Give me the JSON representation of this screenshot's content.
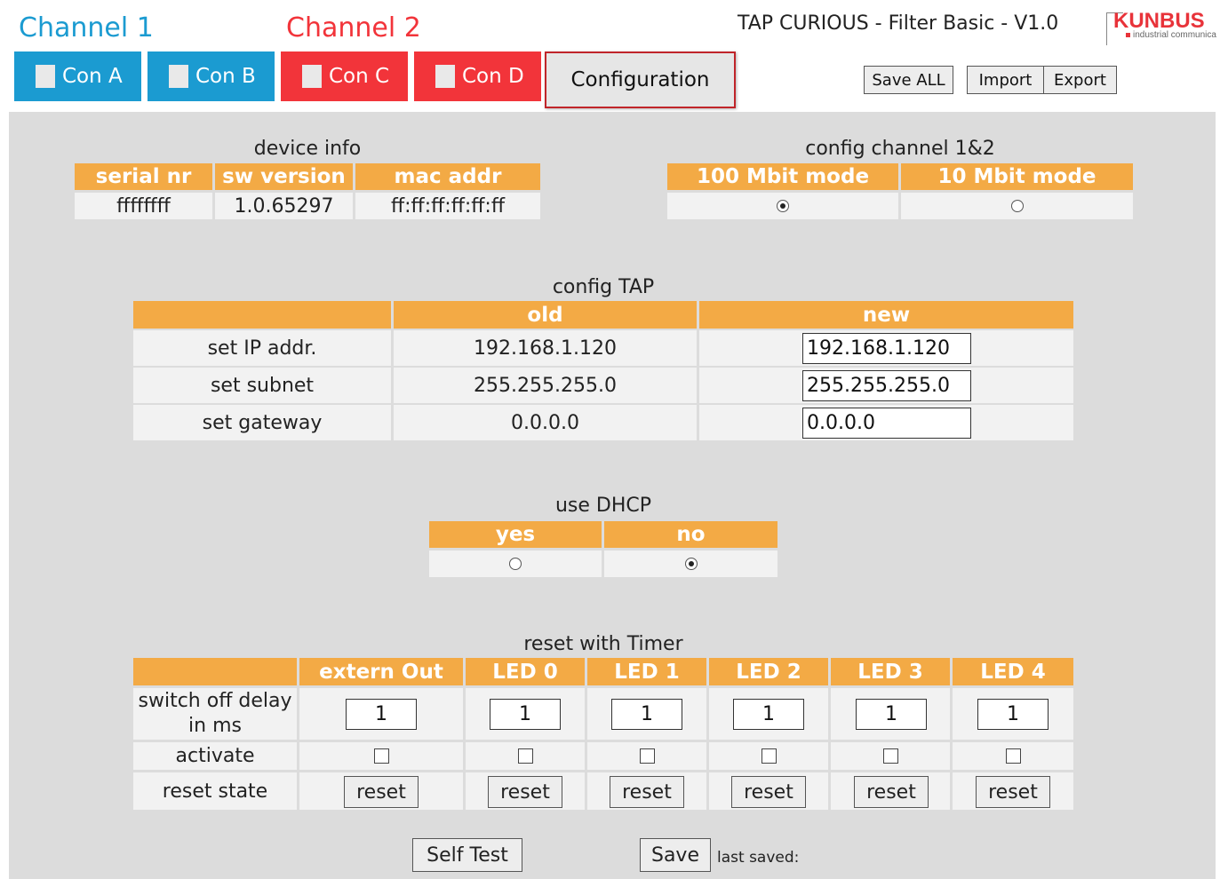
{
  "header": {
    "channel1": "Channel 1",
    "channel2": "Channel 2",
    "app_title": "TAP CURIOUS - Filter Basic - V1.0",
    "logo_text": "KUNBUS",
    "logo_sub": "industrial communica",
    "colors": {
      "channel1": "#1b9bd1",
      "channel2": "#f2343a"
    }
  },
  "tabs": [
    {
      "label": "Con A"
    },
    {
      "label": "Con B"
    },
    {
      "label": "Con C"
    },
    {
      "label": "Con D"
    },
    {
      "label": "Configuration"
    }
  ],
  "toolbar": {
    "save_all": "Save ALL",
    "import": "Import",
    "export": "Export"
  },
  "device_info": {
    "title": "device info",
    "headers": [
      "serial nr",
      "sw version",
      "mac addr"
    ],
    "values": [
      "ffffffff",
      "1.0.65297",
      "ff:ff:ff:ff:ff:ff"
    ]
  },
  "config_channel": {
    "title": "config channel 1&2",
    "headers": [
      "100 Mbit mode",
      "10 Mbit mode"
    ],
    "selected": "100 Mbit mode"
  },
  "config_tap": {
    "title": "config TAP",
    "headers": [
      "",
      "old",
      "new"
    ],
    "rows": [
      {
        "label": "set IP addr.",
        "old": "192.168.1.120",
        "new": "192.168.1.120"
      },
      {
        "label": "set subnet",
        "old": "255.255.255.0",
        "new": "255.255.255.0"
      },
      {
        "label": "set gateway",
        "old": "0.0.0.0",
        "new": "0.0.0.0"
      }
    ]
  },
  "dhcp": {
    "title": "use DHCP",
    "headers": [
      "yes",
      "no"
    ],
    "selected": "no"
  },
  "timer": {
    "title": "reset with Timer",
    "headers": [
      "",
      "extern Out",
      "LED 0",
      "LED 1",
      "LED 2",
      "LED 3",
      "LED 4"
    ],
    "row_delay_label": "switch off delay in ms",
    "row_activate_label": "activate",
    "row_reset_label": "reset state",
    "delays": [
      "1",
      "1",
      "1",
      "1",
      "1",
      "1"
    ],
    "reset_label": "reset"
  },
  "footer": {
    "self_test": "Self Test",
    "save": "Save",
    "last_saved": "last saved:"
  }
}
